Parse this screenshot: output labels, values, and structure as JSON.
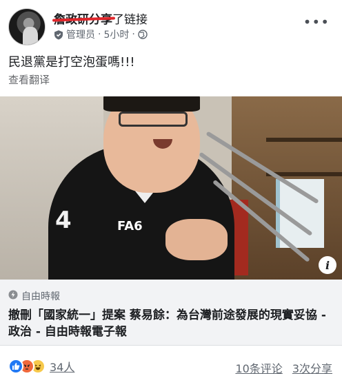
{
  "post": {
    "author_struck": "詹政研分享",
    "author_rest": "了链接",
    "role": "管理员",
    "separator": "·",
    "time": "5小时",
    "text": "民退黨是打空泡蛋嗎!!!",
    "translate_label": "查看翻译"
  },
  "image": {
    "jacket_number": "4",
    "jacket_logo": "FA6",
    "info_glyph": "i"
  },
  "link": {
    "source": "自由時報",
    "title": "撤刪「國家統一」提案 蔡易餘：為台灣前途發展的現實妥協 - 政治 - 自由時報電子報"
  },
  "footer": {
    "reaction_count": "34人",
    "comments": "10条评论",
    "shares": "3次分享"
  },
  "colors": {
    "strike": "#e0262b",
    "like": "#2078f4",
    "angry": "#f0683b",
    "haha": "#f7c94b"
  },
  "icons": [
    "shield-icon",
    "globe-icon",
    "more-icon",
    "bolt-icon",
    "info-icon",
    "like-reaction-icon",
    "angry-reaction-icon",
    "haha-reaction-icon"
  ]
}
